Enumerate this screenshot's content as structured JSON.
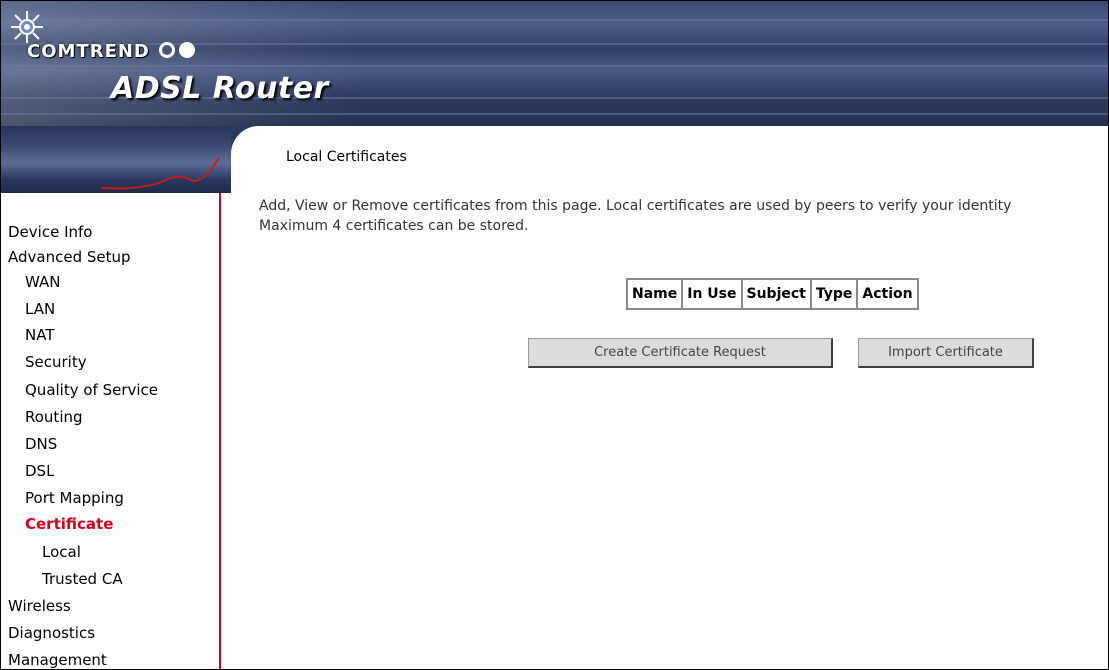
{
  "header": {
    "brand": "COMTREND",
    "product": "ADSL Router"
  },
  "sidebar": {
    "items": [
      {
        "label": "Device Info",
        "level": 0,
        "active": false
      },
      {
        "label": "Advanced Setup",
        "level": 0,
        "active": false
      },
      {
        "label": "WAN",
        "level": 1,
        "active": false
      },
      {
        "label": "LAN",
        "level": 1,
        "active": false
      },
      {
        "label": "NAT",
        "level": 1,
        "active": false
      },
      {
        "label": "Security",
        "level": 1,
        "active": false
      },
      {
        "label": "Quality of Service",
        "level": 1,
        "active": false
      },
      {
        "label": "Routing",
        "level": 1,
        "active": false
      },
      {
        "label": "DNS",
        "level": 1,
        "active": false
      },
      {
        "label": "DSL",
        "level": 1,
        "active": false
      },
      {
        "label": "Port Mapping",
        "level": 1,
        "active": false
      },
      {
        "label": "Certificate",
        "level": 1,
        "active": true
      },
      {
        "label": "Local",
        "level": 2,
        "active": false
      },
      {
        "label": "Trusted CA",
        "level": 2,
        "active": false
      },
      {
        "label": "Wireless",
        "level": 0,
        "active": false
      },
      {
        "label": "Diagnostics",
        "level": 0,
        "active": false
      },
      {
        "label": "Management",
        "level": 0,
        "active": false
      }
    ],
    "active_color": "#d0021b"
  },
  "main": {
    "title": "Local Certificates",
    "description_line1": "Add, View or Remove certificates from this page. Local certificates are used by peers to verify your identity",
    "description_line2": "Maximum 4 certificates can be stored.",
    "table": {
      "columns": [
        "Name",
        "In Use",
        "Subject",
        "Type",
        "Action"
      ]
    },
    "buttons": {
      "create": "Create Certificate Request",
      "import": "Import Certificate"
    }
  }
}
